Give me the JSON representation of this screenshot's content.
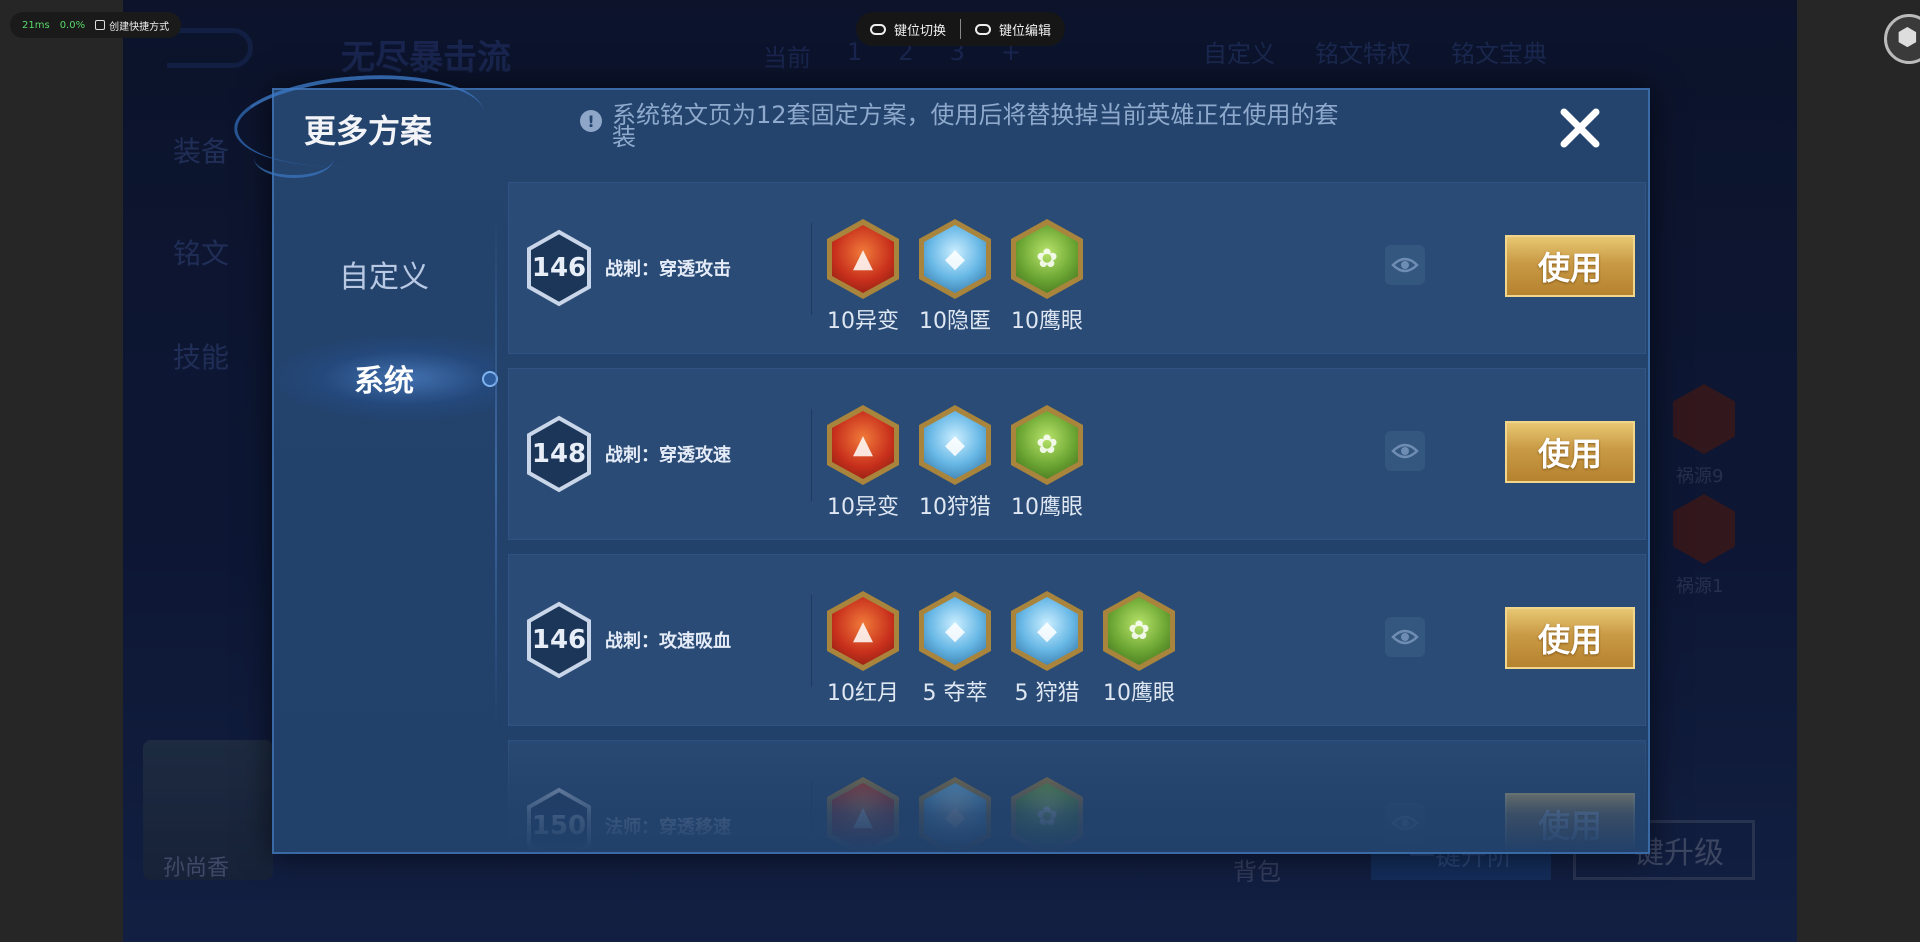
{
  "overlay": {
    "perf": {
      "latency": "21ms",
      "loss": "0.0%",
      "shortcut": "创建快捷方式"
    },
    "keybar": {
      "switch_label": "键位切换",
      "edit_label": "键位编辑"
    }
  },
  "background": {
    "title": "无尽暴击流",
    "tabs": [
      "当前",
      "1",
      "2",
      "3",
      "+"
    ],
    "right_tabs": [
      "自定义",
      "铭文特权",
      "铭文宝典"
    ],
    "side": [
      "装备",
      "铭文",
      "技能"
    ],
    "hero_name": "孙尚香",
    "bag": "背包",
    "upgrade_left": "一键升阶",
    "upgrade_right": "一键升级",
    "badges": [
      "祸源9",
      "祸源1"
    ]
  },
  "dialog": {
    "title": "更多方案",
    "notice": "系统铭文页为12套固定方案，使用后将替换掉当前英雄正在使用的套装",
    "nav": [
      {
        "label": "自定义",
        "active": false
      },
      {
        "label": "系统",
        "active": true
      }
    ],
    "use_label": "使用",
    "presets": [
      {
        "level": "146",
        "name": "战刺：穿透攻击",
        "runes": [
          {
            "label": "10异变",
            "color": "red",
            "icon": "mutation-rune-icon"
          },
          {
            "label": "10隐匿",
            "color": "blue",
            "icon": "stealth-rune-icon"
          },
          {
            "label": "10鹰眼",
            "color": "green",
            "icon": "hawkeye-rune-icon"
          }
        ]
      },
      {
        "level": "148",
        "name": "战刺：穿透攻速",
        "runes": [
          {
            "label": "10异变",
            "color": "red",
            "icon": "mutation-rune-icon"
          },
          {
            "label": "10狩猎",
            "color": "blue",
            "icon": "hunt-rune-icon"
          },
          {
            "label": "10鹰眼",
            "color": "green",
            "icon": "hawkeye-rune-icon"
          }
        ]
      },
      {
        "level": "146",
        "name": "战刺：攻速吸血",
        "runes": [
          {
            "label": "10红月",
            "color": "red",
            "icon": "red-moon-rune-icon"
          },
          {
            "label": "5 夺萃",
            "color": "blue",
            "icon": "plunder-rune-icon"
          },
          {
            "label": "5 狩猎",
            "color": "blue",
            "icon": "hunt-rune-icon"
          },
          {
            "label": "10鹰眼",
            "color": "green",
            "icon": "hawkeye-rune-icon"
          }
        ]
      },
      {
        "level": "150",
        "name": "法师：穿透移速",
        "runes": [
          {
            "label": "",
            "color": "red",
            "icon": "red-rune-icon"
          },
          {
            "label": "",
            "color": "blue",
            "icon": "blue-rune-icon"
          },
          {
            "label": "",
            "color": "green",
            "icon": "green-rune-icon"
          }
        ]
      }
    ]
  },
  "colors": {
    "accent_gold": "#c99a45",
    "panel_blue": "#24446d",
    "row_blue": "#2a4b75"
  }
}
